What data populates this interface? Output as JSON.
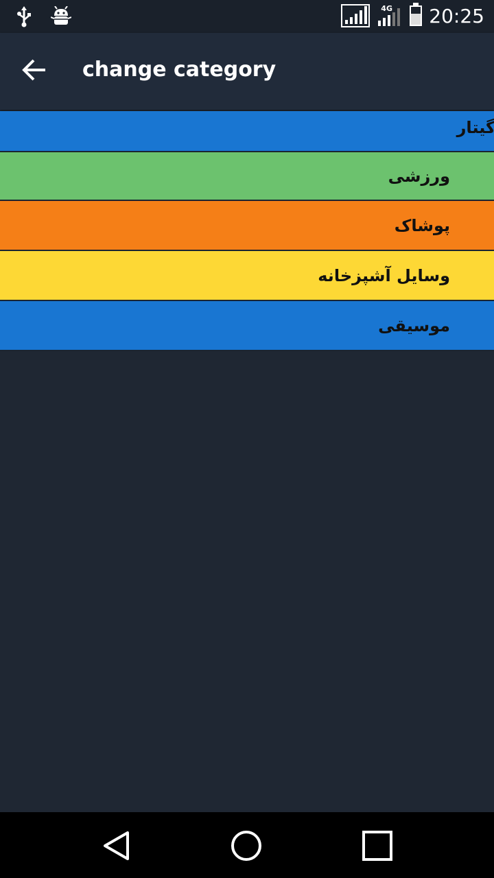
{
  "status_bar": {
    "time": "20:25",
    "network_type": "4G",
    "icons": [
      "usb-icon",
      "android-debug-icon",
      "signal-sim1-icon",
      "signal-sim2-icon",
      "battery-charging-icon"
    ]
  },
  "app_bar": {
    "title": "change category",
    "back_icon": "arrow-left-icon"
  },
  "categories": [
    {
      "label": "گیتار",
      "color": "#1976d2"
    },
    {
      "label": "ورزشی",
      "color": "#6cc26e"
    },
    {
      "label": "پوشاک",
      "color": "#f57f17"
    },
    {
      "label": "وسایل آشپزخانه",
      "color": "#fdd835"
    },
    {
      "label": "موسیقی",
      "color": "#1976d2"
    }
  ],
  "nav_bar": {
    "icons": [
      "back-triangle-icon",
      "home-circle-icon",
      "recents-square-icon"
    ]
  }
}
